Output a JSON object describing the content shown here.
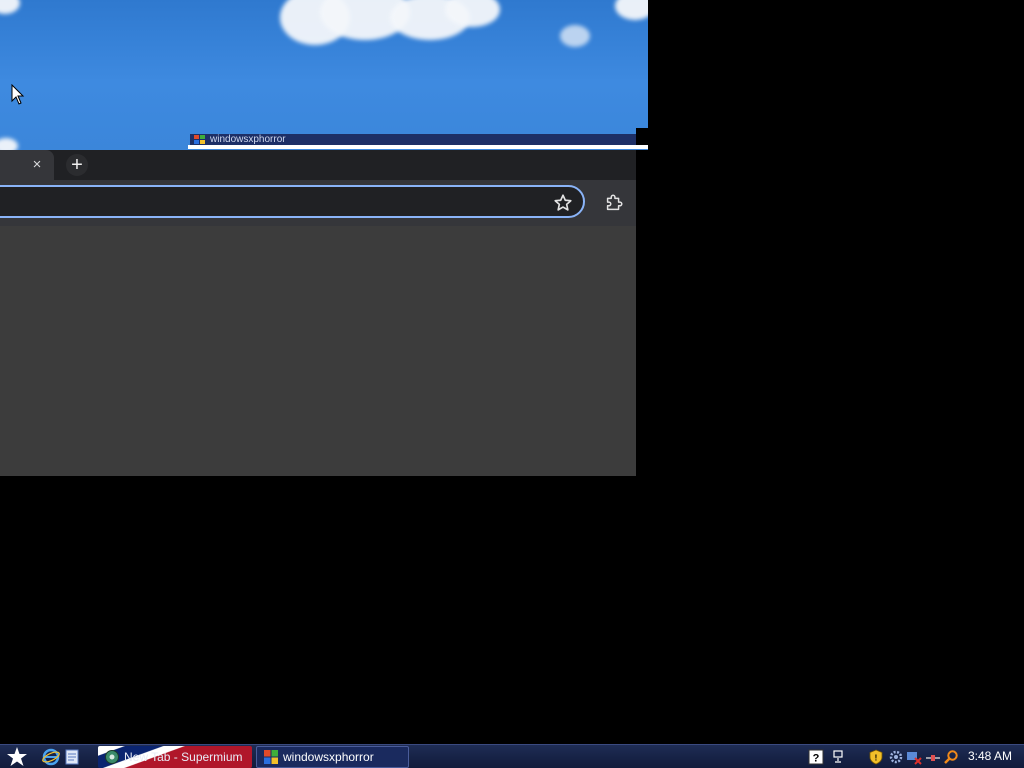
{
  "desktop": {
    "wallpaper": "blue sky with clouds",
    "colors": {
      "sky": "#3e8ae0",
      "cloud": "#f4f7fb"
    }
  },
  "mini_window": {
    "title": "windowsxphorror"
  },
  "browser": {
    "tab_close_label": "×",
    "new_tab_label": "+",
    "address_value": "",
    "colors": {
      "tabstrip": "#202124",
      "toolbar": "#35363a",
      "omnibox_border": "#8ab4f8",
      "content": "#3c3c3c"
    }
  },
  "taskbar": {
    "tasks": [
      {
        "label": "New Tab - Supermium",
        "icon": "supermium-icon"
      },
      {
        "label": "windowsxphorror",
        "icon": "windows-flag-icon"
      }
    ],
    "quick_launch": [
      "internet-explorer-icon",
      "documents-icon",
      "supermium-icon"
    ],
    "tray_icons": [
      "help-icon",
      "network-icon",
      "shield-icon",
      "gear-icon",
      "security-alert-icon",
      "connection-icon",
      "search-icon"
    ],
    "clock": "3:48 AM"
  }
}
